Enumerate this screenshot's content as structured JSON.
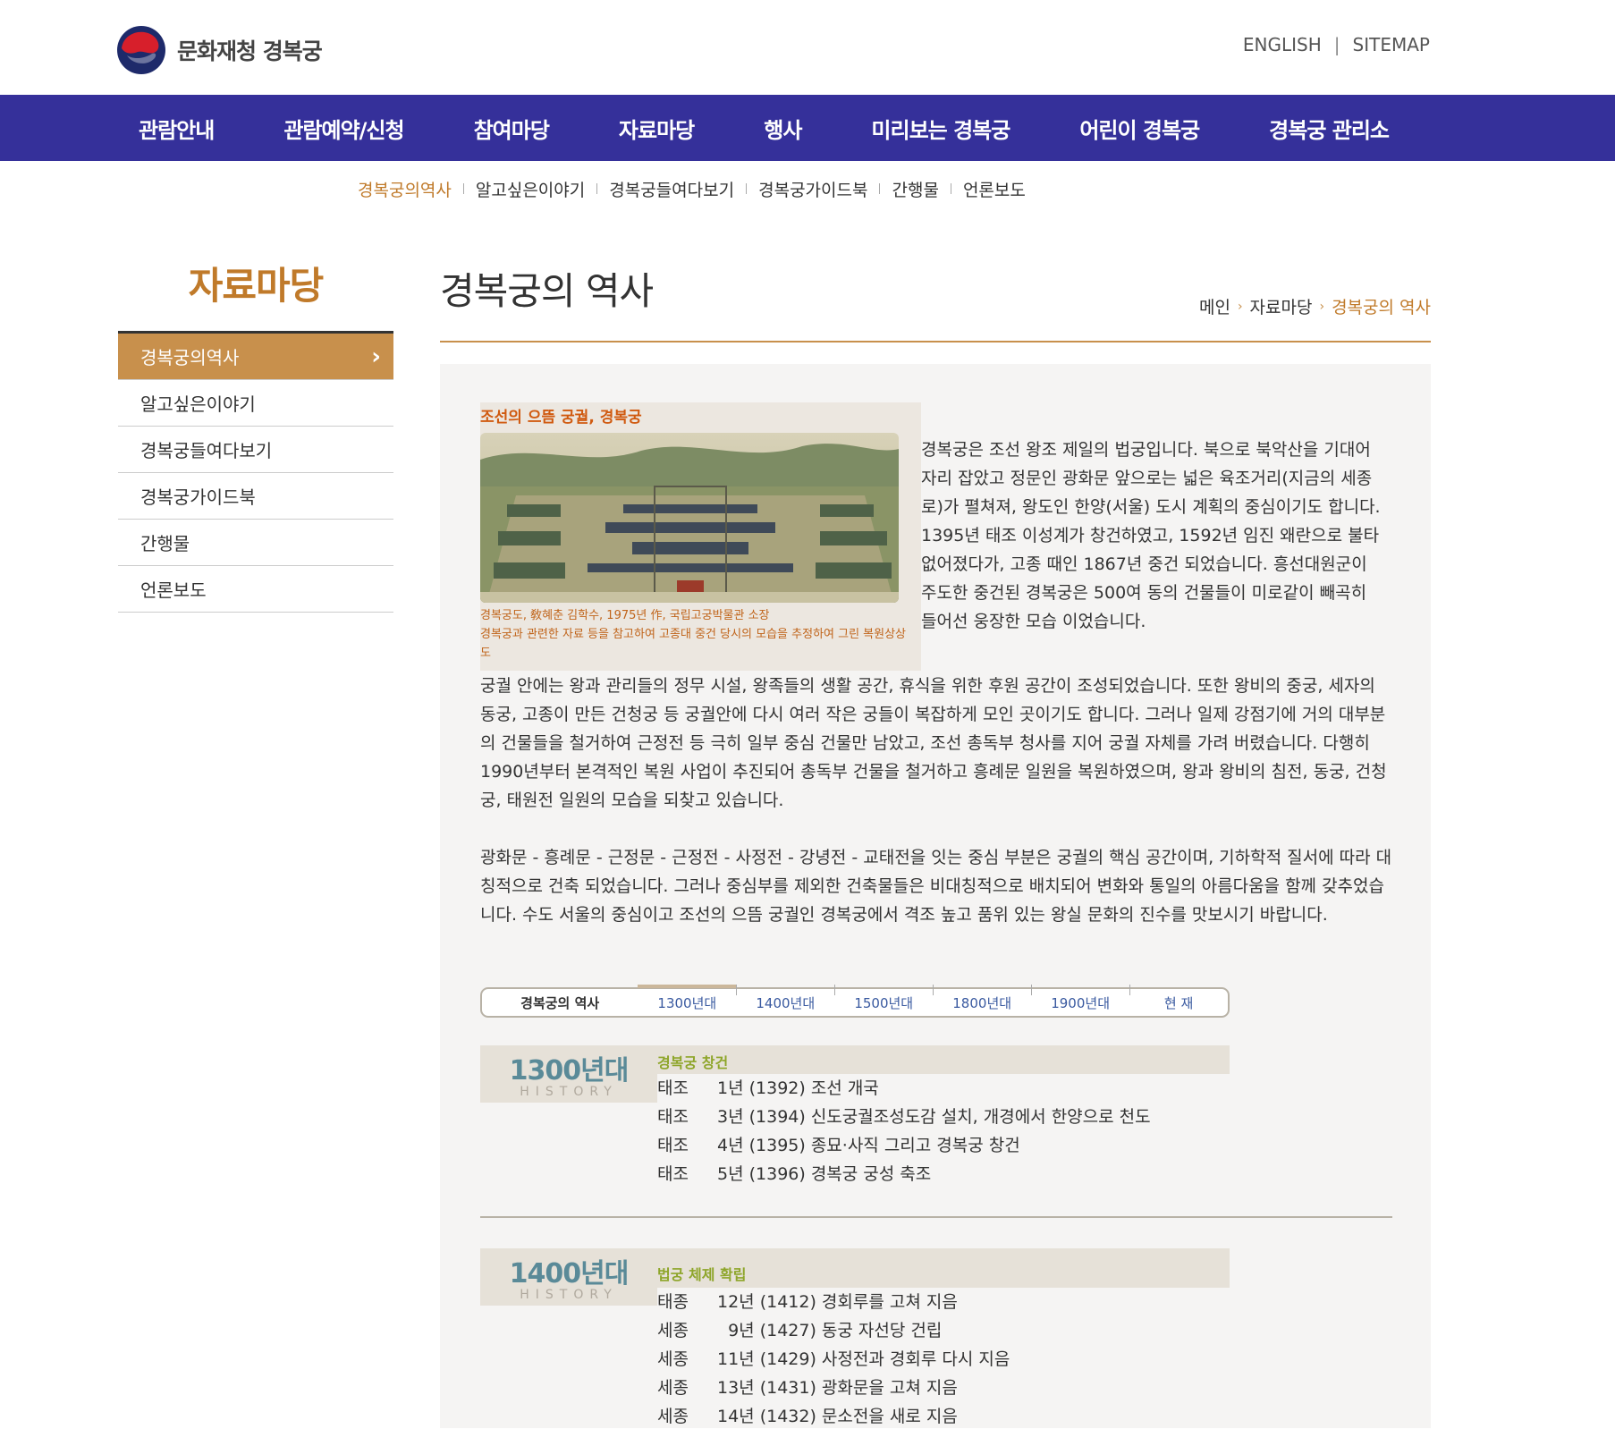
{
  "header": {
    "logo_text": "문화재청 경복궁",
    "english": "ENGLISH",
    "sitemap": "SITEMAP",
    "sep": "|"
  },
  "gnb": [
    "관람안내",
    "관람예약/신청",
    "참여마당",
    "자료마당",
    "행사",
    "미리보는 경복궁",
    "어린이 경복궁",
    "경복궁 관리소"
  ],
  "sub_menu": [
    "경복궁의역사",
    "알고싶은이야기",
    "경복궁들여다보기",
    "경복궁가이드북",
    "간행물",
    "언론보도"
  ],
  "sidebar": {
    "title": "자료마당",
    "items": [
      "경복궁의역사",
      "알고싶은이야기",
      "경복궁들여다보기",
      "경복궁가이드북",
      "간행물",
      "언론보도"
    ],
    "active_arrow": "›"
  },
  "page": {
    "title": "경복궁의 역사",
    "breadcrumb": [
      "메인",
      "자료마당",
      "경복궁의 역사"
    ]
  },
  "figure": {
    "title": "조선의 으뜸 궁궐, 경복궁",
    "note1": "경복궁도, 敎혜춘 김학수, 1975년 作, 국립고궁박물관 소장",
    "note2": "경복궁과 관련한 자료 등을 참고하여 고종대 중건 당시의 모습을 추정하여 그린 복원상상도"
  },
  "intro": "경복궁은 조선 왕조 제일의 법궁입니다. 북으로 북악산을 기대어 자리 잡았고 정문인 광화문 앞으로는 넓은 육조거리(지금의 세종로)가 펼쳐져, 왕도인 한양(서울) 도시 계획의 중심이기도 합니다. 1395년 태조 이성계가 창건하였고, 1592년 임진 왜란으로 불타 없어졌다가, 고종 때인 1867년 중건 되었습니다. 흥선대원군이 주도한 중건된 경복궁은 500여 동의 건물들이 미로같이 빼곡히 들어선 웅장한 모습 이었습니다.",
  "body1": "궁궐 안에는 왕과 관리들의 정무 시설, 왕족들의 생활 공간, 휴식을 위한 후원 공간이 조성되었습니다. 또한 왕비의 중궁, 세자의 동궁, 고종이 만든 건청궁 등 궁궐안에 다시 여러 작은 궁들이 복잡하게 모인 곳이기도 합니다. 그러나 일제 강점기에 거의 대부분의 건물들을 철거하여 근정전 등 극히 일부 중심 건물만 남았고, 조선 총독부 청사를 지어 궁궐 자체를 가려 버렸습니다. 다행히 1990년부터 본격적인 복원 사업이 추진되어 총독부 건물을 철거하고 흥례문 일원을 복원하였으며, 왕과 왕비의 침전, 동궁, 건청궁, 태원전 일원의 모습을 되찾고 있습니다.",
  "body2": "광화문 - 흥례문 - 근정문 - 근정전 - 사정전 - 강녕전 - 교태전을 잇는 중심 부분은 궁궐의 핵심 공간이며, 기하학적 질서에 따라 대칭적으로 건축 되었습니다. 그러나 중심부를 제외한 건축물들은 비대칭적으로 배치되어 변화와 통일의 아름다움을 함께 갖추었습니다. 수도 서울의 중심이고 조선의 으뜸 궁궐인 경복궁에서 격조 높고 품위 있는 왕실 문화의 진수를 맛보시기 바랍니다.",
  "tabs": [
    "경복궁의 역사",
    "1300년대",
    "1400년대",
    "1500년대",
    "1800년대",
    "1900년대",
    "현 재"
  ],
  "eras": [
    {
      "year": "1300년대",
      "sub": "HISTORY",
      "head": "경복궁 창건",
      "rows": [
        {
          "king": "태조",
          "text": "1년 (1392) 조선 개국"
        },
        {
          "king": "태조",
          "text": "3년 (1394) 신도궁궐조성도감 설치, 개경에서 한양으로 천도"
        },
        {
          "king": "태조",
          "text": "4년 (1395) 종묘·사직 그리고 경복궁 창건"
        },
        {
          "king": "태조",
          "text": "5년 (1396) 경복궁 궁성 축조"
        }
      ]
    },
    {
      "year": "1400년대",
      "sub": "HISTORY",
      "head": "법궁 체제 확립",
      "rows": [
        {
          "king": "태종",
          "text": "12년 (1412) 경회루를 고쳐 지음"
        },
        {
          "king": "세종",
          "text": "  9년 (1427) 동궁 자선당 건립"
        },
        {
          "king": "세종",
          "text": "11년 (1429) 사정전과 경회루 다시 지음"
        },
        {
          "king": "세종",
          "text": "13년 (1431) 광화문을 고쳐 지음"
        },
        {
          "king": "세종",
          "text": "14년 (1432) 문소전을 새로 지음"
        }
      ]
    }
  ],
  "colors": {
    "gnb": "#35309a",
    "accent": "#c07a2a",
    "sidebar_active": "#c8904c",
    "era_head": "#8ea52a",
    "era_year": "#5a8a98"
  }
}
